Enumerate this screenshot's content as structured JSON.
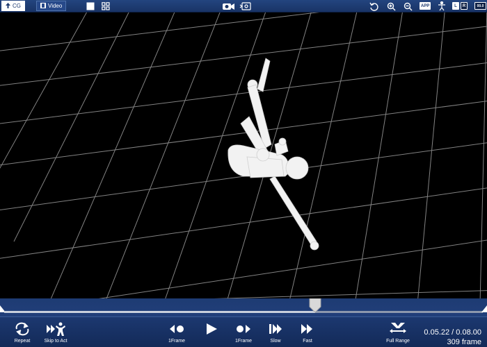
{
  "toolbar": {
    "cg_tab": "CG",
    "video_tab": "Video",
    "app_badge": "APP",
    "left_badge": "L",
    "right_badge": "R",
    "speed_badge": "00.0",
    "icons": [
      "up-arrow-icon",
      "film-icon",
      "square-icon",
      "grid-icon",
      "camera-icon",
      "view-switch-icon",
      "reset-rotation-icon",
      "zoom-in-icon",
      "zoom-out-icon",
      "figure-icon"
    ]
  },
  "timeline": {
    "progress": 0.65
  },
  "controls": {
    "repeat": "Repeat",
    "skip_to_act": "Skip to Act",
    "prev_frame": "1Frame",
    "play": "",
    "next_frame": "1Frame",
    "slow": "Slow",
    "fast": "Fast",
    "full_range": "Full Range"
  },
  "readout": {
    "time": "0.05.22 / 0.08.00",
    "frames": "309 frame"
  },
  "colors": {
    "bar": "#1c3870",
    "accent": "#ffffff",
    "grid": "#9a9a9a"
  }
}
